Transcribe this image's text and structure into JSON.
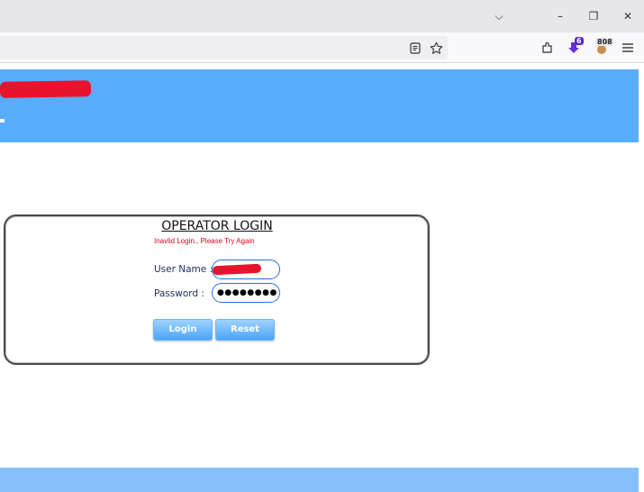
{
  "browser": {
    "controls": {
      "chevron": "⌵",
      "minimize": "–",
      "restore": "❐",
      "close": "✕"
    },
    "toolbar_icons": [
      "reader-view-icon",
      "bookmark-star-icon",
      "extensions-icon",
      "download-icon",
      "extension-badge-icon",
      "menu-icon"
    ],
    "download_badge": "6",
    "extension_badge": "808"
  },
  "login": {
    "title": "OPERATOR LOGIN",
    "error": "Inavlid Login., Please Try Again",
    "username_label": "User Name :",
    "password_label": "Password :",
    "password_value": "●●●●●●●●",
    "login_button": "Login",
    "reset_button": "Reset"
  },
  "colors": {
    "header": "#58adff",
    "footer": "#86c0fa",
    "error": "#e0001b",
    "redaction": "#e8142e"
  }
}
